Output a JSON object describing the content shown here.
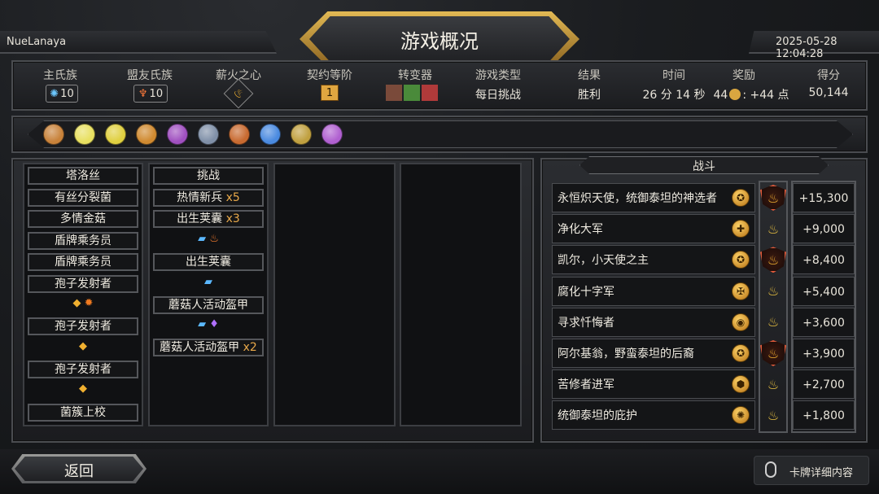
{
  "header": {
    "player": "NueLanaya",
    "title": "游戏概况",
    "datetime": "2025-05-28 12:04:28"
  },
  "stats": [
    {
      "label": "主氏族",
      "value": "10"
    },
    {
      "label": "盟友氏族",
      "value": "10"
    },
    {
      "label": "薪火之心",
      "value": ""
    },
    {
      "label": "契约等阶",
      "value": "1"
    },
    {
      "label": "转变器",
      "value": ""
    },
    {
      "label": "游戏类型",
      "value": "每日挑战"
    },
    {
      "label": "结果",
      "value": "胜利"
    },
    {
      "label": "时间",
      "value": "26 分 14 秒"
    },
    {
      "label": "奖励",
      "value": "44",
      "value2": ": +44 点"
    },
    {
      "label": "得分",
      "value": "50,144"
    }
  ],
  "artifacts": [
    "artifact-1-icon",
    "artifact-2-icon",
    "artifact-3-icon",
    "artifact-4-icon",
    "artifact-5-icon",
    "artifact-6-icon",
    "artifact-7-icon",
    "artifact-8-icon",
    "artifact-9-icon",
    "artifact-10-icon"
  ],
  "deck_col1": [
    "塔洛丝",
    "有丝分裂菌",
    "多情金菇",
    "盾牌乘务员",
    "盾牌乘务员",
    "孢子发射者",
    "孢子发射者",
    "孢子发射者",
    "菌簇上校"
  ],
  "deck_col2": {
    "c1": "挑战",
    "c2": "热情新兵",
    "c2m": "x5",
    "c3": "出生荚囊",
    "c3m": "x3",
    "c4": "出生荚囊",
    "c5": "蘑菇人活动盔甲",
    "c6": "蘑菇人活动盔甲",
    "c6m": "x2"
  },
  "battle": {
    "title": "战斗",
    "rows": [
      {
        "name": "永恒炽天使，统御泰坦的神选者",
        "score": "+15,300",
        "boss": true
      },
      {
        "name": "净化大军",
        "score": "+9,000",
        "boss": false
      },
      {
        "name": "凯尔，小天使之主",
        "score": "+8,400",
        "boss": true
      },
      {
        "name": "腐化十字军",
        "score": "+5,400",
        "boss": false
      },
      {
        "name": "寻求忏悔者",
        "score": "+3,600",
        "boss": false
      },
      {
        "name": "阿尔基翁，野蛮泰坦的后裔",
        "score": "+3,900",
        "boss": true
      },
      {
        "name": "苦修者进军",
        "score": "+2,700",
        "boss": false
      },
      {
        "name": "统御泰坦的庇护",
        "score": "+1,800",
        "boss": false
      }
    ]
  },
  "footer": {
    "back": "返回",
    "card_details": "卡牌详细内容"
  },
  "colors": {
    "gold": "#d9a640",
    "accent": "#e9a94a"
  }
}
